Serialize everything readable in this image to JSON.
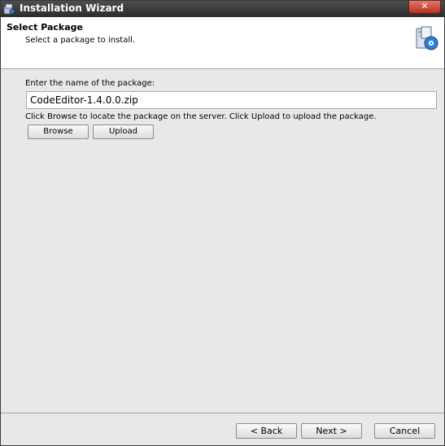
{
  "window": {
    "title": "Installation Wizard",
    "close_label": "✕"
  },
  "header": {
    "title": "Select Package",
    "subtitle": "Select a package to install."
  },
  "form": {
    "name_label": "Enter the name of the package:",
    "package_value": "CodeEditor-1.4.0.0.zip",
    "hint": "Click Browse to locate the package on the server. Click Upload to upload the package.",
    "browse_label": "Browse",
    "upload_label": "Upload"
  },
  "footer": {
    "back_label": "< Back",
    "next_label": "Next >",
    "cancel_label": "Cancel"
  },
  "icons": {
    "title": "installer-icon",
    "header": "package-install-icon",
    "close": "close-icon"
  }
}
